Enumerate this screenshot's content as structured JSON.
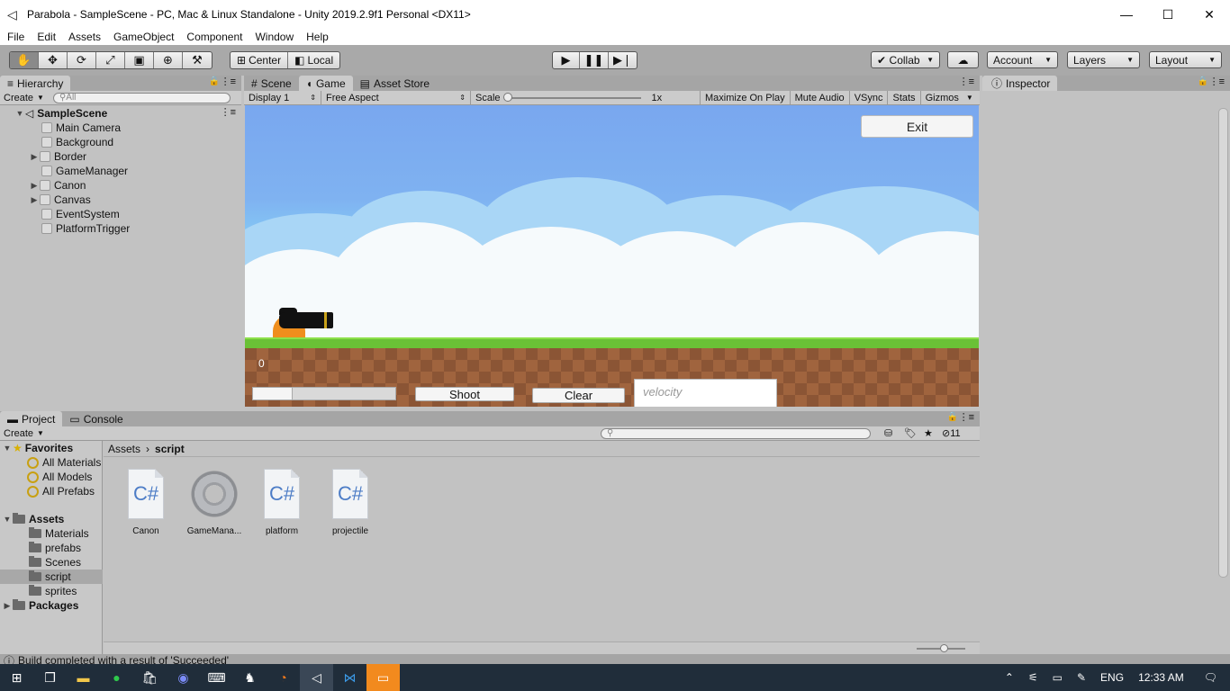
{
  "window": {
    "title": "Parabola - SampleScene - PC, Mac & Linux Standalone - Unity 2019.2.9f1 Personal <DX11>",
    "minimize": "—",
    "maximize": "☐",
    "close": "✕"
  },
  "menu": [
    "File",
    "Edit",
    "Assets",
    "GameObject",
    "Component",
    "Window",
    "Help"
  ],
  "toolbar": {
    "pivot": "Center",
    "space": "Local",
    "collab": "Collab",
    "account": "Account",
    "layers": "Layers",
    "layout": "Layout"
  },
  "hierarchy": {
    "tab": "Hierarchy",
    "create": "Create",
    "search_placeholder": "All",
    "scene": "SampleScene",
    "items": [
      "Main Camera",
      "Background",
      "Border",
      "GameManager",
      "Canon",
      "Canvas",
      "EventSystem",
      "PlatformTrigger"
    ]
  },
  "game_view": {
    "tabs": [
      "Scene",
      "Game",
      "Asset Store"
    ],
    "display": "Display 1",
    "aspect": "Free Aspect",
    "scale_label": "Scale",
    "scale_value": "1x",
    "maximize": "Maximize On Play",
    "mute": "Mute Audio",
    "vsync": "VSync",
    "stats": "Stats",
    "gizmos": "Gizmos",
    "exit": "Exit",
    "score": "0",
    "shoot": "Shoot",
    "clear": "Clear",
    "velocity_placeholder": "velocity",
    "slider_value": 0.28
  },
  "inspector": {
    "tab": "Inspector"
  },
  "project": {
    "tabs": [
      "Project",
      "Console"
    ],
    "create": "Create",
    "hidden_count": "11",
    "favorites": "Favorites",
    "favorite_items": [
      "All Materials",
      "All Models",
      "All Prefabs"
    ],
    "assets": "Assets",
    "folders": [
      "Materials",
      "prefabs",
      "Scenes",
      "script",
      "sprites"
    ],
    "packages": "Packages",
    "breadcrumb": [
      "Assets",
      "script"
    ],
    "files": [
      "Canon",
      "GameMana...",
      "platform",
      "projectile"
    ],
    "cs_label": "C#"
  },
  "status": "Build completed with a result of 'Succeeded'",
  "taskbar": {
    "lang": "ENG",
    "time": "12:33 AM"
  }
}
